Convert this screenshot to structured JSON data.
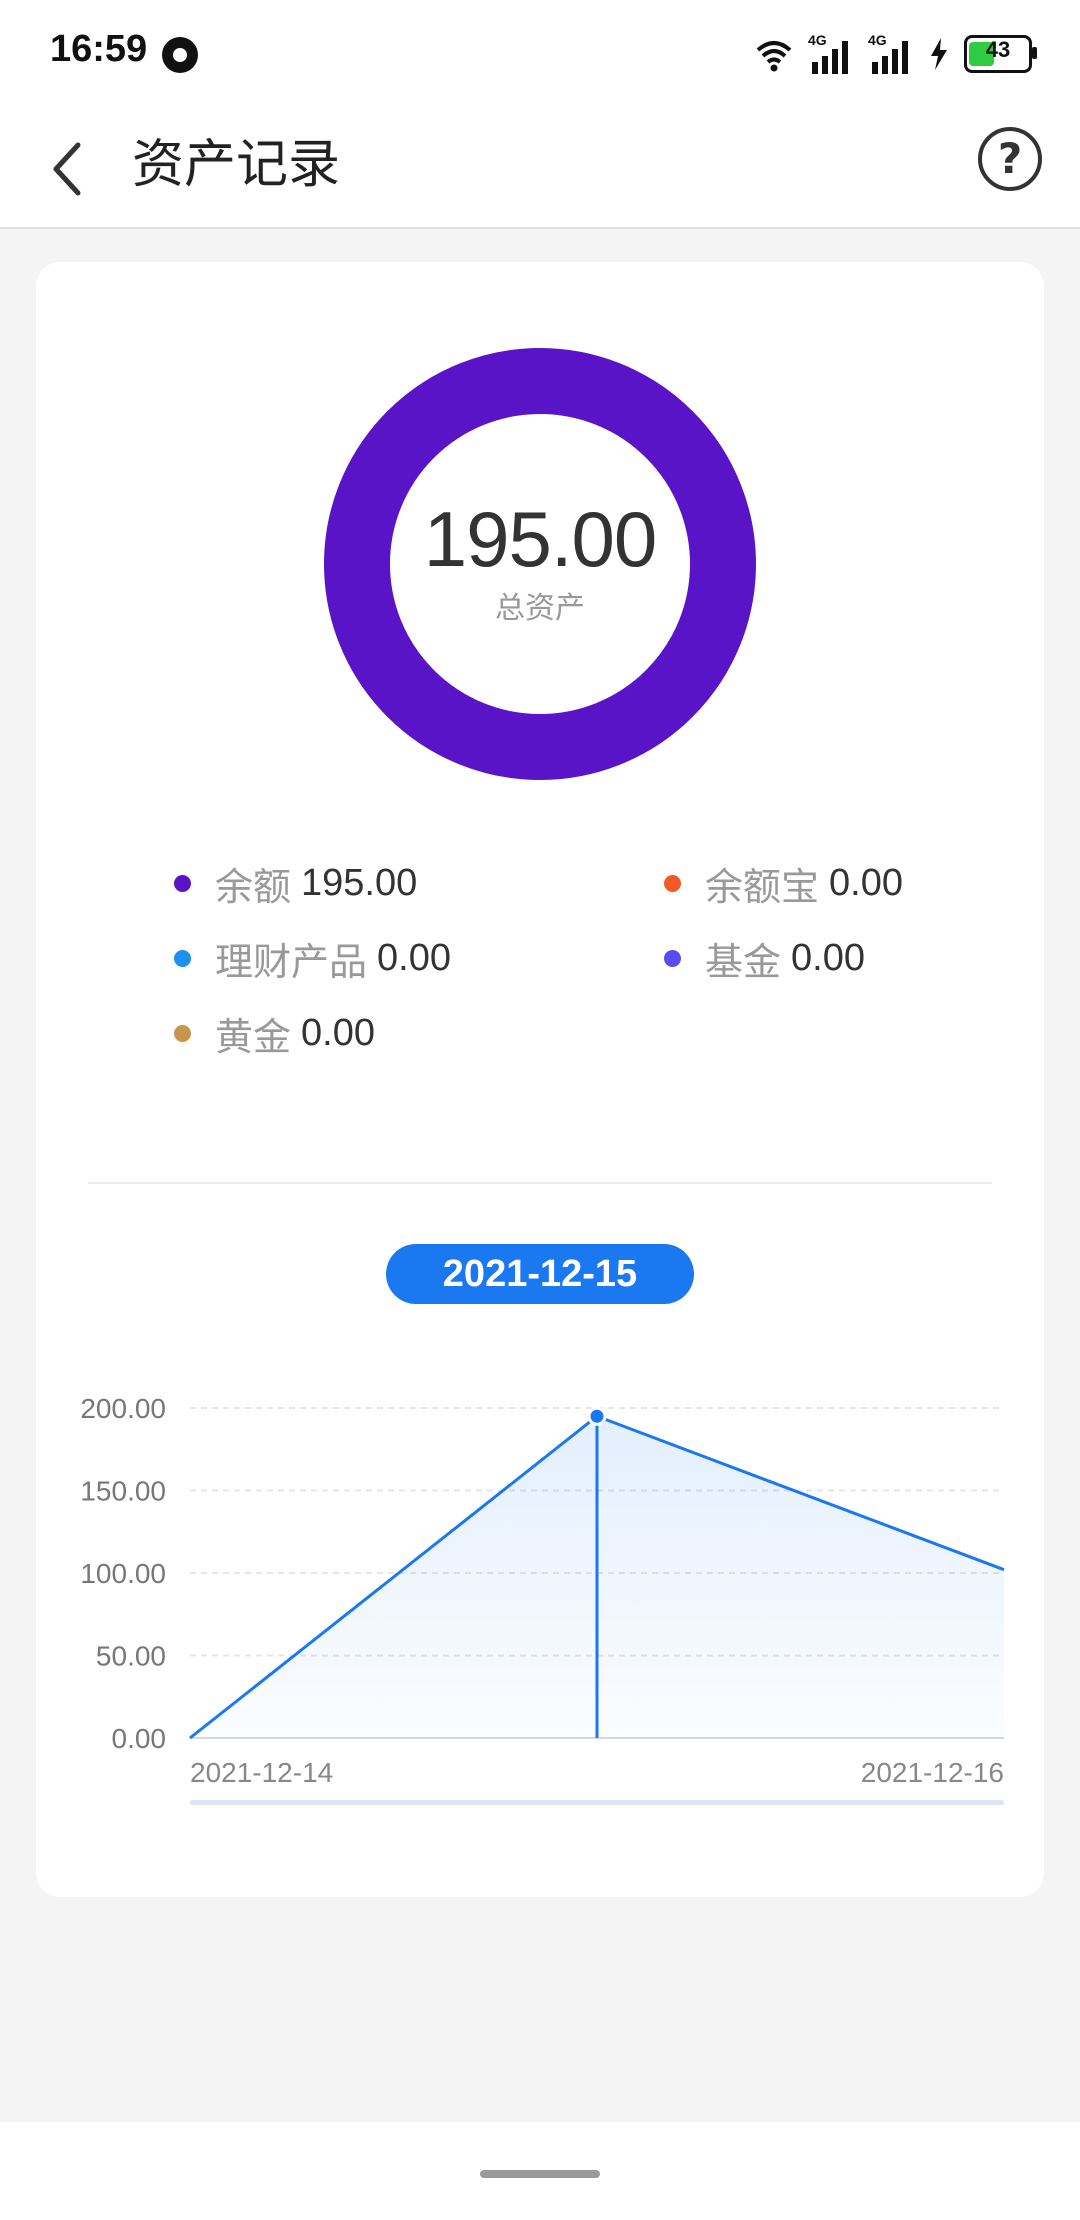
{
  "status_bar": {
    "time": "16:59",
    "icons": [
      "app-notification-icon",
      "wifi-icon",
      "signal-4g-icon",
      "signal-4g-icon",
      "charging-icon",
      "battery-icon"
    ],
    "network_label": "4G",
    "battery_level": "43",
    "battery_fraction": 0.43
  },
  "header": {
    "title": "资产记录",
    "back_icon": "chevron-left-icon",
    "help_label": "?"
  },
  "summary": {
    "total_value": "195.00",
    "total_label": "总资产",
    "ring_color": "#5a14c8",
    "legend": [
      {
        "name": "余额",
        "value": "195.00",
        "color": "#5a14c8"
      },
      {
        "name": "余额宝",
        "value": "0.00",
        "color": "#f05a28"
      },
      {
        "name": "理财产品",
        "value": "0.00",
        "color": "#1e90f0"
      },
      {
        "name": "基金",
        "value": "0.00",
        "color": "#5a4cf0"
      },
      {
        "name": "黄金",
        "value": "0.00",
        "color": "#c8964b"
      }
    ]
  },
  "selected_date": "2021-12-15",
  "chart_data": {
    "type": "area",
    "x": [
      "2021-12-14",
      "2021-12-15",
      "2021-12-16"
    ],
    "series": [
      {
        "values": [
          0,
          195,
          102
        ]
      }
    ],
    "y_ticks": [
      "0.00",
      "50.00",
      "100.00",
      "150.00",
      "200.00"
    ],
    "x_tick_labels": [
      "2021-12-14",
      "2021-12-16"
    ],
    "ylim": [
      0,
      200
    ],
    "highlight_index": 1,
    "line_color": "#1a78f0",
    "grid": true
  }
}
